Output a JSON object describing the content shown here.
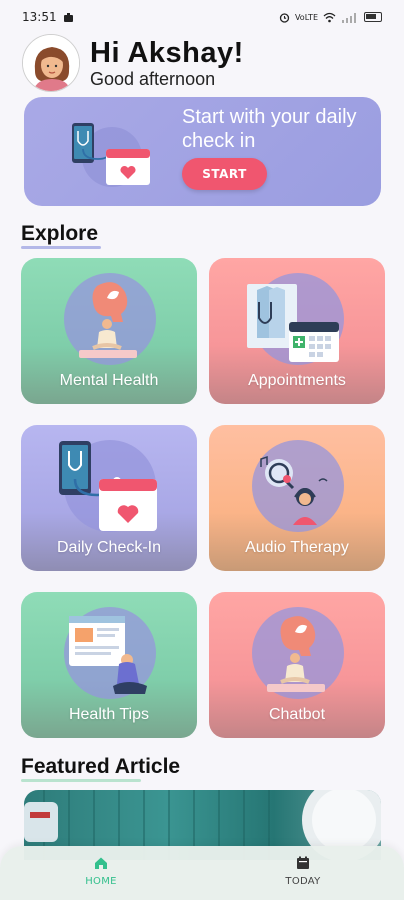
{
  "status": {
    "time": "13:51",
    "network": "VoLTE",
    "battery": "100"
  },
  "header": {
    "greeting": "Hi Akshay!",
    "subtitle": "Good afternoon"
  },
  "banner": {
    "text": "Start with your daily check in",
    "button": "START"
  },
  "explore": {
    "title": "Explore",
    "cards": [
      {
        "label": "Mental Health"
      },
      {
        "label": "Appointments"
      },
      {
        "label": "Daily Check-In"
      },
      {
        "label": "Audio Therapy"
      },
      {
        "label": "Health Tips"
      },
      {
        "label": "Chatbot"
      }
    ]
  },
  "featured": {
    "title": "Featured Article"
  },
  "nav": {
    "home": "HOME",
    "today": "TODAY"
  },
  "colors": {
    "accent": "#34c08d",
    "start_button": "#f0566f",
    "banner": "#a9a9e6"
  }
}
